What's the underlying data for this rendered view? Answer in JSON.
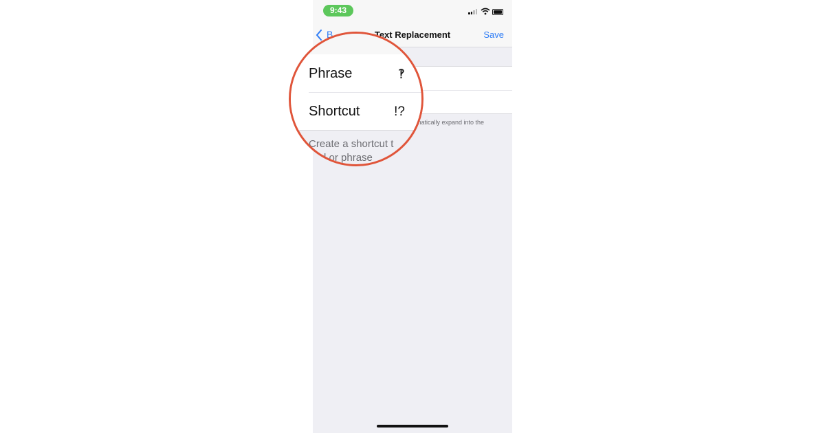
{
  "status_bar": {
    "time": "9:43"
  },
  "nav": {
    "back_label": "B",
    "title": "Text Replacement",
    "save_label": "Save"
  },
  "form": {
    "phrase_label": "Phrase",
    "phrase_value": "‽",
    "shortcut_label": "Shortcut",
    "shortcut_value": "!?"
  },
  "footer": {
    "visible_fragment": "omatically expand into the",
    "magnified_line1": "Create a shortcut t",
    "magnified_line2": "rd or phrase"
  },
  "colors": {
    "accent": "#2f7df6",
    "highlight_ring": "#e0553a",
    "time_pill": "#5cc75b"
  }
}
